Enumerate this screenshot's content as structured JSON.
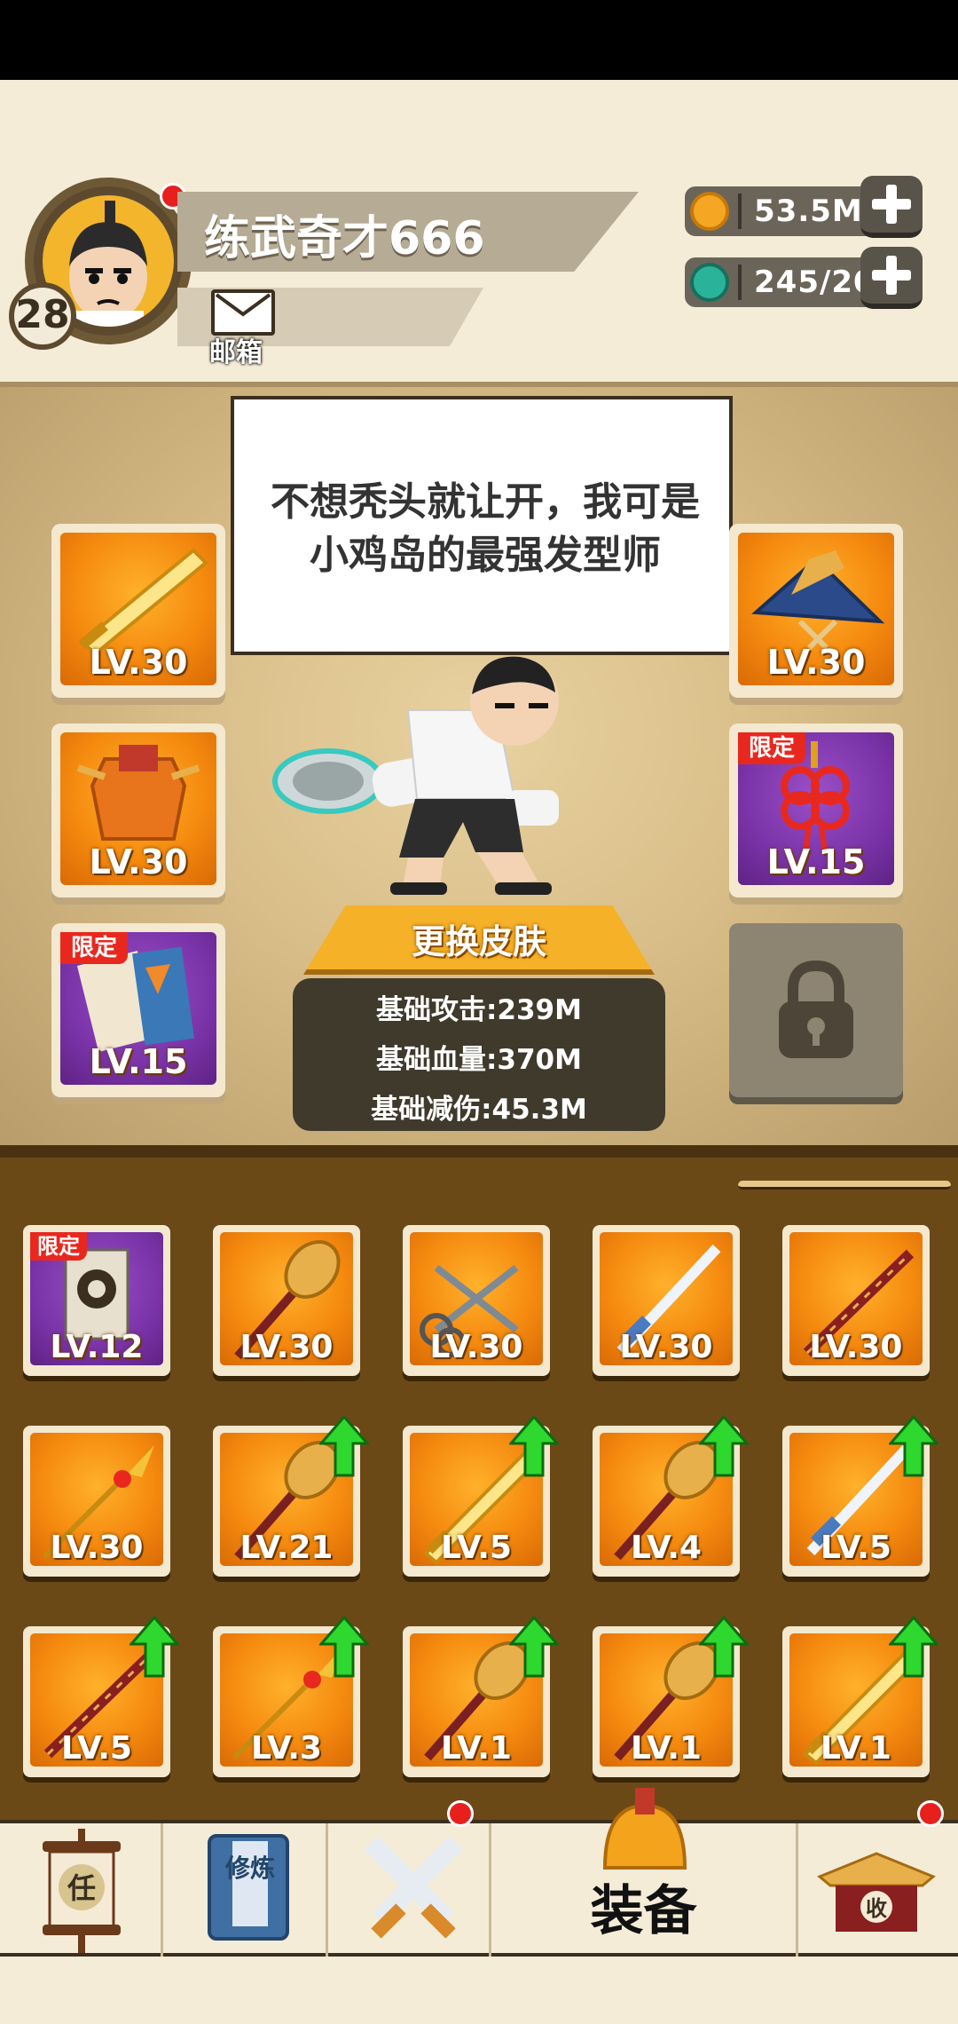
{
  "player": {
    "name": "练武奇才666",
    "level": "28",
    "mail_label": "邮箱"
  },
  "resources": [
    {
      "name": "gold",
      "value": "53.5M",
      "color": "#f5a623"
    },
    {
      "name": "jade",
      "value": "245/20",
      "color": "#2bb39a"
    }
  ],
  "speech": "不想秃头就让开，我可是小鸡岛的最强发型师",
  "equipped": {
    "left": [
      {
        "icon": "golden-sword-icon",
        "level": "LV.30",
        "limited": false
      },
      {
        "icon": "armor-icon",
        "level": "LV.30",
        "limited": false
      },
      {
        "icon": "book-icon",
        "level": "LV.15",
        "limited": true
      }
    ],
    "right": [
      {
        "icon": "hat-icon",
        "level": "LV.30",
        "limited": false
      },
      {
        "icon": "knot-charm-icon",
        "level": "LV.15",
        "limited": true
      },
      {
        "icon": "lock-icon",
        "locked": true
      }
    ],
    "limited_tag": "限定"
  },
  "skin_button": "更换皮肤",
  "stats": [
    "基础攻击:239M",
    "基础血量:370M",
    "基础减伤:45.3M"
  ],
  "inventory": [
    {
      "icon": "talisman-icon",
      "level": "LV.12",
      "limited": true,
      "upgrade": false
    },
    {
      "icon": "mace-icon",
      "level": "LV.30",
      "limited": false,
      "upgrade": false
    },
    {
      "icon": "scissors-icon",
      "level": "LV.30",
      "limited": false,
      "upgrade": false
    },
    {
      "icon": "blue-sword-icon",
      "level": "LV.30",
      "limited": false,
      "upgrade": false
    },
    {
      "icon": "staff-icon",
      "level": "LV.30",
      "limited": false,
      "upgrade": false
    },
    {
      "icon": "spear-icon",
      "level": "LV.30",
      "limited": false,
      "upgrade": false
    },
    {
      "icon": "mace-icon",
      "level": "LV.21",
      "limited": false,
      "upgrade": true
    },
    {
      "icon": "golden-sword-icon",
      "level": "LV.5",
      "limited": false,
      "upgrade": true
    },
    {
      "icon": "mace-icon",
      "level": "LV.4",
      "limited": false,
      "upgrade": true
    },
    {
      "icon": "blue-sword-icon",
      "level": "LV.5",
      "limited": false,
      "upgrade": true
    },
    {
      "icon": "staff-icon",
      "level": "LV.5",
      "limited": false,
      "upgrade": true
    },
    {
      "icon": "spear-icon",
      "level": "LV.3",
      "limited": false,
      "upgrade": true
    },
    {
      "icon": "mace-icon",
      "level": "LV.1",
      "limited": false,
      "upgrade": true
    },
    {
      "icon": "mace-icon",
      "level": "LV.1",
      "limited": false,
      "upgrade": true
    },
    {
      "icon": "golden-sword-icon",
      "level": "LV.1",
      "limited": false,
      "upgrade": true
    }
  ],
  "nav": [
    {
      "icon": "task-scroll-icon",
      "glyph": "任",
      "label": "",
      "dot": false
    },
    {
      "icon": "training-book-icon",
      "glyph": "修炼",
      "label": "",
      "dot": false
    },
    {
      "icon": "crossed-swords-icon",
      "label": "",
      "dot": true
    },
    {
      "icon": "equipment-helmet-icon",
      "label": "装备",
      "dot": false,
      "active": true
    },
    {
      "icon": "collect-house-icon",
      "glyph": "收",
      "label": "",
      "dot": true
    }
  ]
}
